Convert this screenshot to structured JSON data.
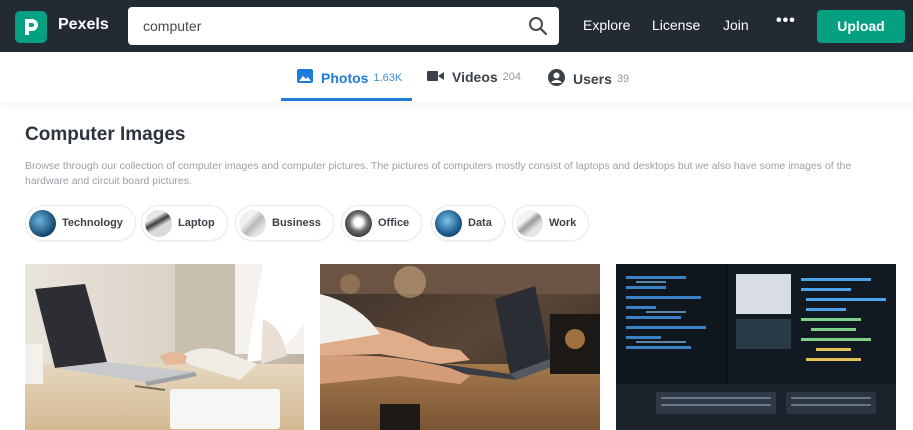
{
  "header": {
    "brand": "Pexels",
    "search_value": "computer",
    "nav": [
      "Explore",
      "License",
      "Join"
    ],
    "more_label": "•••",
    "upload_label": "Upload",
    "icons": [
      "pexels-logo-icon",
      "search-icon",
      "more-icon"
    ]
  },
  "tabs": [
    {
      "label": "Photos",
      "count": "1.63K",
      "icon": "photo-icon",
      "active": true
    },
    {
      "label": "Videos",
      "count": "204",
      "icon": "video-icon",
      "active": false
    },
    {
      "label": "Users",
      "count": "39",
      "icon": "user-icon",
      "active": false
    }
  ],
  "page": {
    "title": "Computer Images",
    "description": "Browse through our collection of computer images and computer pictures. The pictures of computers mostly consist of laptops and desktops but we also have some images of the hardware and circuit board pictures."
  },
  "chips": [
    {
      "label": "Technology"
    },
    {
      "label": "Laptop"
    },
    {
      "label": "Business"
    },
    {
      "label": "Office"
    },
    {
      "label": "Data"
    },
    {
      "label": "Work"
    }
  ],
  "photos": [
    {
      "subject": "laptop on white desk"
    },
    {
      "subject": "hands typing on laptop in cafe"
    },
    {
      "subject": "computer monitors showing code"
    }
  ],
  "colors": {
    "header_bg": "#232a34",
    "brand_green": "#05a081",
    "active_tab": "#1e7cd9"
  }
}
